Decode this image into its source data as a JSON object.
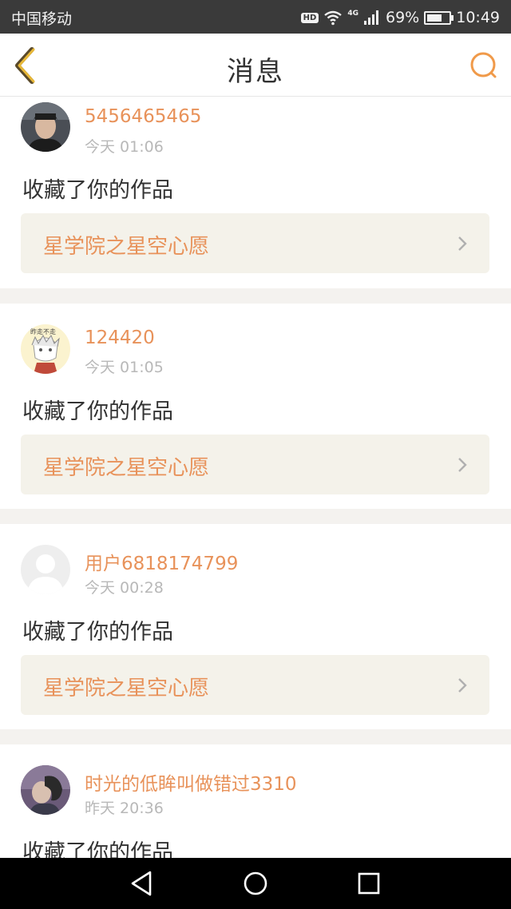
{
  "status_bar": {
    "carrier": "中国移动",
    "hd": "HD",
    "network": "4G",
    "battery_percent": "69%",
    "battery_level": 0.69,
    "time": "10:49"
  },
  "header": {
    "title": "消息",
    "back_icon": "chevron-left-icon",
    "search_icon": "search-icon",
    "accent_color": "#e8a038"
  },
  "messages": [
    {
      "username": "5456465465",
      "time": "今天 01:06",
      "action": "收藏了你的作品",
      "work_title": "星学院之星空心愿",
      "avatar": "avatar-photo"
    },
    {
      "username": "124420",
      "time": "今天 01:05",
      "action": "收藏了你的作品",
      "work_title": "星学院之星空心愿",
      "avatar": "avatar-anime"
    },
    {
      "username": "用户6818174799",
      "time": "今天 00:28",
      "action": "收藏了你的作品",
      "work_title": "星学院之星空心愿",
      "avatar": "avatar-default"
    },
    {
      "username": "时光的低眸叫做错过3310",
      "time": "昨天 20:36",
      "action": "收藏了你的作品",
      "avatar": "avatar-photo"
    }
  ],
  "colors": {
    "username": "#e8925a",
    "work_box_bg": "#f4f2ea",
    "divider": "#f4f2ef"
  },
  "nav": {
    "back_icon": "triangle-back-icon",
    "home_icon": "circle-home-icon",
    "recents_icon": "square-recents-icon"
  }
}
